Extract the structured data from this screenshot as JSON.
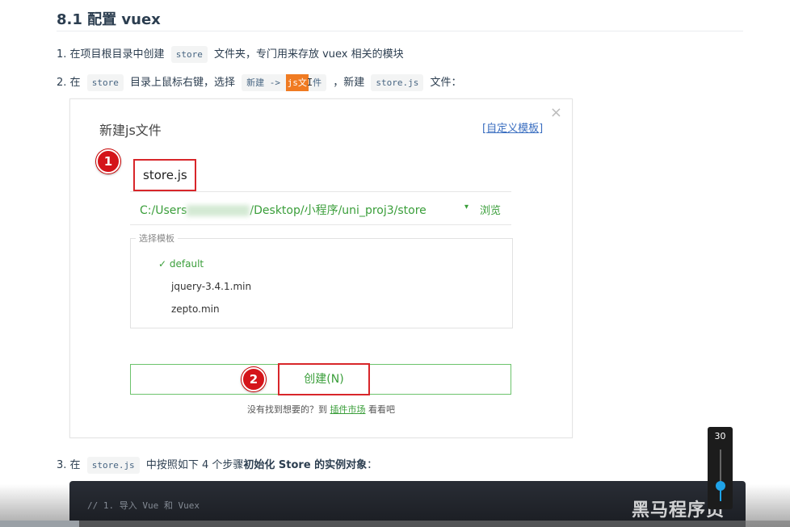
{
  "section": {
    "title": "8.1 配置 vuex"
  },
  "steps": {
    "s1": {
      "num": "1.",
      "a": "在项目根目录中创建",
      "code": "store",
      "b": "文件夹，专门用来存放 vuex 相关的模块"
    },
    "s2": {
      "num": "2.",
      "a": "在",
      "code1": "store",
      "b": "目录上鼠标右键，选择",
      "code2_pre": "新建 -> ",
      "code2_hl": "js文",
      "code2_post": "件",
      "c": "，新建",
      "code3": "store.js",
      "d": "文件："
    },
    "s3": {
      "num": "3.",
      "a": "在",
      "code": "store.js",
      "b": "中按照如下 4 个步骤",
      "bold": "初始化 Store 的实例对象",
      "c": "："
    }
  },
  "dialog": {
    "title": "新建js文件",
    "custom_template_prefix": "[",
    "custom_template": "自定义模板",
    "custom_template_suffix": "]",
    "close_glyph": "×",
    "file_name": "store.js",
    "path_prefix": "C:/Users",
    "path_suffix": "/Desktop/小程序/uni_proj3/store",
    "path_arrow": "▾",
    "browse_label": "浏览",
    "template_legend": "选择模板",
    "templates": [
      "default",
      "jquery-3.4.1.min",
      "zepto.min"
    ],
    "selected_check": "✓",
    "create_label": "创建(N)",
    "footer_a": "没有找到想要的？到",
    "footer_link": "插件市场",
    "footer_b": "看看吧",
    "badge1": "1",
    "badge2": "2"
  },
  "code": {
    "line1": "// 1. 导入 Vue 和 Vuex"
  },
  "video": {
    "volume": "30",
    "volume_fraction": 0.3,
    "watermark": "黑马程序员",
    "progress_fraction": 0.1
  },
  "colors": {
    "accent_green": "#3a9e3a",
    "annotation_red": "#d8262a",
    "highlight_orange": "#f07b22"
  }
}
